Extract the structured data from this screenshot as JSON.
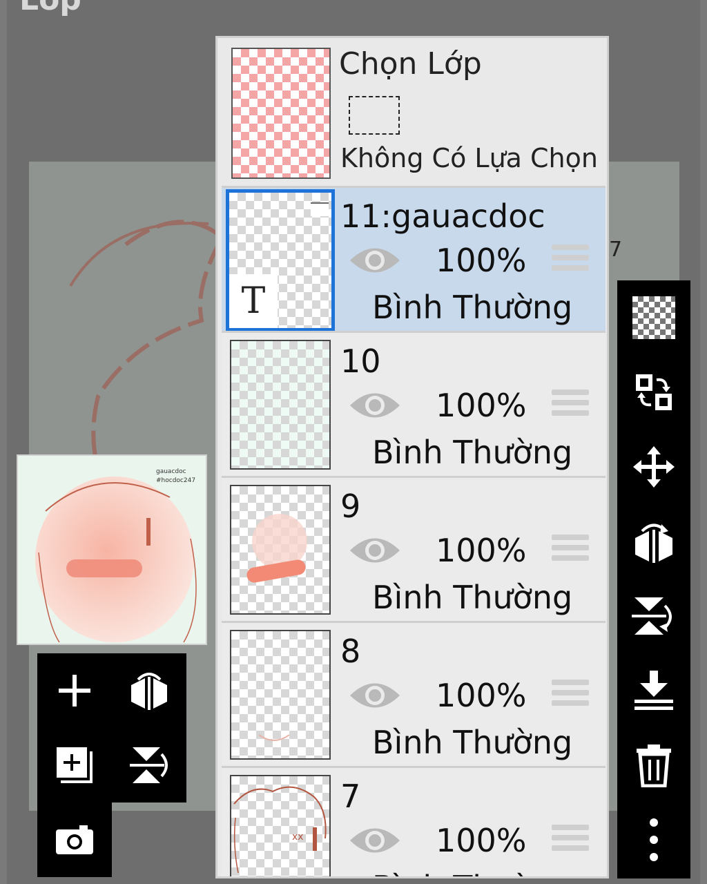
{
  "title": "Lớp",
  "selection": {
    "title": "Chọn Lớp",
    "status": "Không Có Lựa Chọn"
  },
  "layers": [
    {
      "name": "11:gauacdoc",
      "opacity": "100%",
      "blend": "Bình Thường",
      "active": true,
      "type_glyph": "T",
      "thumb_text": "gauacdoc #hocdoc247"
    },
    {
      "name": "10",
      "opacity": "100%",
      "blend": "Bình Thường",
      "active": false
    },
    {
      "name": "9",
      "opacity": "100%",
      "blend": "Bình Thường",
      "active": false
    },
    {
      "name": "8",
      "opacity": "100%",
      "blend": "Bình Thường",
      "active": false
    },
    {
      "name": "7",
      "opacity": "100%",
      "blend": "Bình Thường",
      "active": false
    }
  ],
  "preview": {
    "line1": "gauacdoc",
    "line2": "#hocdoc247"
  },
  "background_fragment": "7",
  "left_toolbar": [
    "add-layer-icon",
    "flip-horizontal-icon",
    "duplicate-layer-icon",
    "flip-vertical-icon",
    "camera-icon"
  ],
  "right_toolbar": [
    "transparency-icon",
    "swap-layer-icon",
    "move-icon",
    "flip-horizontal-icon",
    "flip-vertical-icon",
    "merge-down-icon",
    "delete-icon",
    "more-icon"
  ],
  "colors": {
    "active_layer": "#c9d9ec",
    "accent": "#1e73d8",
    "panel": "#e9e9e9"
  }
}
